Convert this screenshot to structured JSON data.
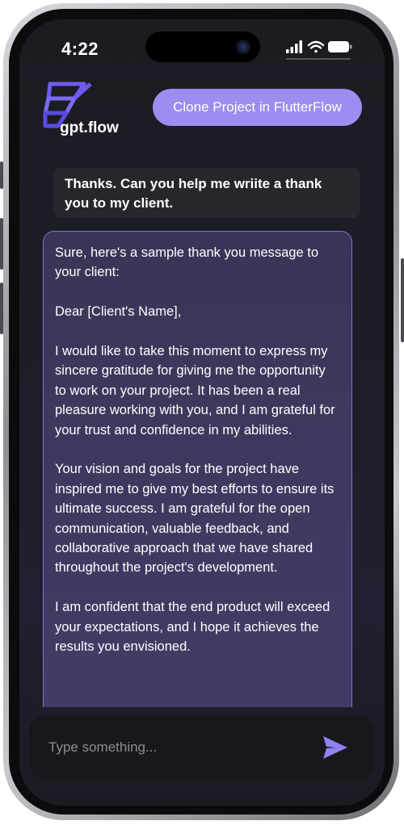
{
  "status_bar": {
    "time": "4:22",
    "icons": [
      "signal-icon",
      "wifi-icon",
      "battery-icon"
    ]
  },
  "header": {
    "brand_name": "gpt.flow",
    "logo_icon": "gpt-flow-logo-icon",
    "clone_button_label": "Clone Project in FlutterFlow"
  },
  "chat": {
    "messages": [
      {
        "role": "user",
        "text": "Thanks. Can you help me wriite a thank you to my client."
      },
      {
        "role": "assistant",
        "paragraphs": [
          "Sure, here's a sample thank you message to your client:",
          "Dear [Client's Name],",
          "I would like to take this moment to express my sincere gratitude for giving me the opportunity to work on your project. It has been a real pleasure working with you, and I am grateful for your trust and confidence in my abilities.",
          "Your vision and goals for the project have inspired me to give my best efforts to ensure its ultimate success. I am grateful for the open communication, valuable feedback, and collaborative approach that we have shared throughout the project's development.",
          "I am confident that the end product will exceed your expectations, and I hope it achieves the results you envisioned."
        ]
      }
    ]
  },
  "composer": {
    "placeholder": "Type something...",
    "value": "",
    "send_icon": "send-icon"
  },
  "colors": {
    "accent": "#9b8ef0",
    "bubble_border": "#7b73d6",
    "send": "#8f82f2"
  }
}
